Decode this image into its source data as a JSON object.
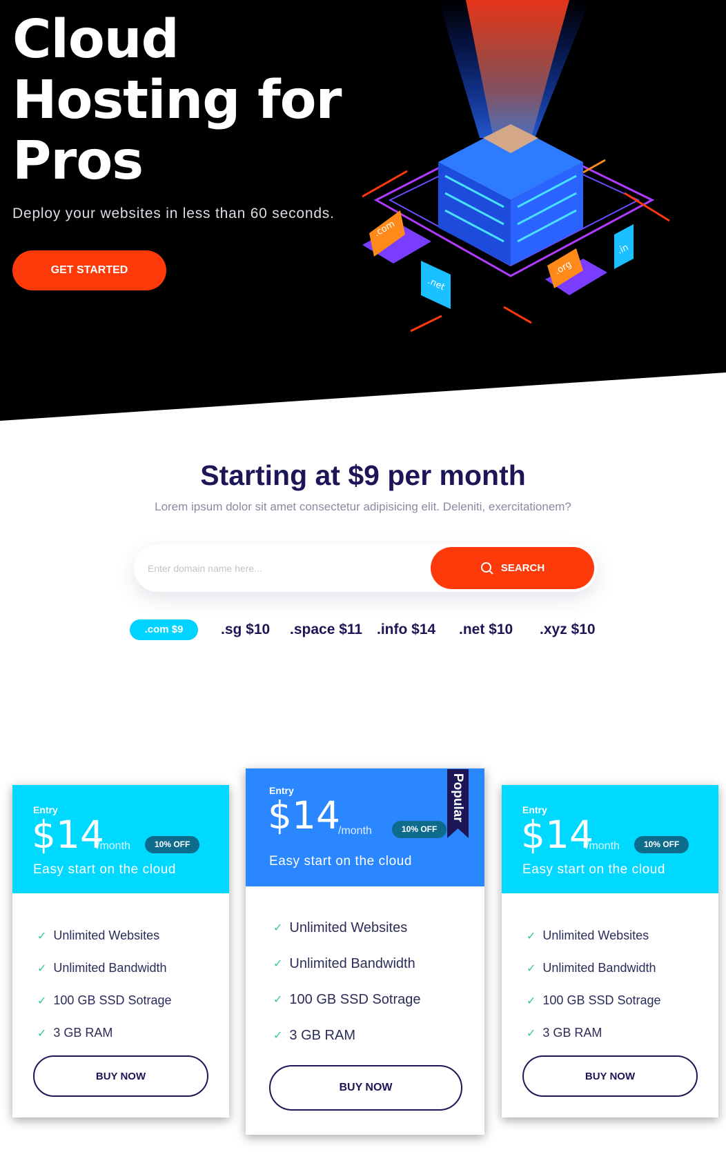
{
  "hero": {
    "title": "Cloud Hosting for Pros",
    "subtitle": "Deploy your websites in less than 60 seconds.",
    "cta_label": "GET STARTED",
    "illustration": {
      "icon": "server-cloud-illustration",
      "labels": [
        ".com",
        ".net",
        ".org",
        ".in"
      ]
    }
  },
  "pricing": {
    "title": "Starting at $9 per month",
    "subtitle": "Lorem ipsum dolor sit amet consectetur adipisicing elit. Deleniti, exercitationem?"
  },
  "search": {
    "placeholder": "Enter domain name here...",
    "button_label": "SEARCH",
    "icon": "search-icon"
  },
  "tlds": [
    {
      "label": ".com $9",
      "active": true
    },
    {
      "label": ".sg $10",
      "active": false
    },
    {
      "label": ".space $11",
      "active": false
    },
    {
      "label": ".info $14",
      "active": false
    },
    {
      "label": ".net $10",
      "active": false
    },
    {
      "label": ".xyz $10",
      "active": false
    }
  ],
  "plans": [
    {
      "tier": "Entry",
      "price": "$14",
      "period": "/month",
      "discount": "10% OFF",
      "tagline": "Easy start on the cloud",
      "features": [
        "Unlimited Websites",
        "Unlimited Bandwidth",
        "100 GB SSD Sotrage",
        "3 GB RAM"
      ],
      "button_label": "BUY NOW",
      "color": "#00d9ff"
    },
    {
      "tier": "Entry",
      "price": "$14",
      "period": "/month",
      "discount": "10% OFF",
      "tagline": "Easy start on the cloud",
      "features": [
        "Unlimited Websites",
        "Unlimited Bandwidth",
        "100 GB SSD Sotrage",
        "3 GB RAM"
      ],
      "button_label": "BUY NOW",
      "color": "#2b87ff",
      "ribbon": "Popular"
    },
    {
      "tier": "Entry",
      "price": "$14",
      "period": "/month",
      "discount": "10% OFF",
      "tagline": "Easy start on the cloud",
      "features": [
        "Unlimited Websites",
        "Unlimited Bandwidth",
        "100 GB SSD Sotrage",
        "3 GB RAM"
      ],
      "button_label": "BUY NOW",
      "color": "#00d9ff"
    }
  ],
  "colors": {
    "accent": "#ff3a0a",
    "navy": "#1c1656",
    "cyan": "#00d9ff",
    "blue": "#2b87ff",
    "check": "#2ec4a0"
  }
}
